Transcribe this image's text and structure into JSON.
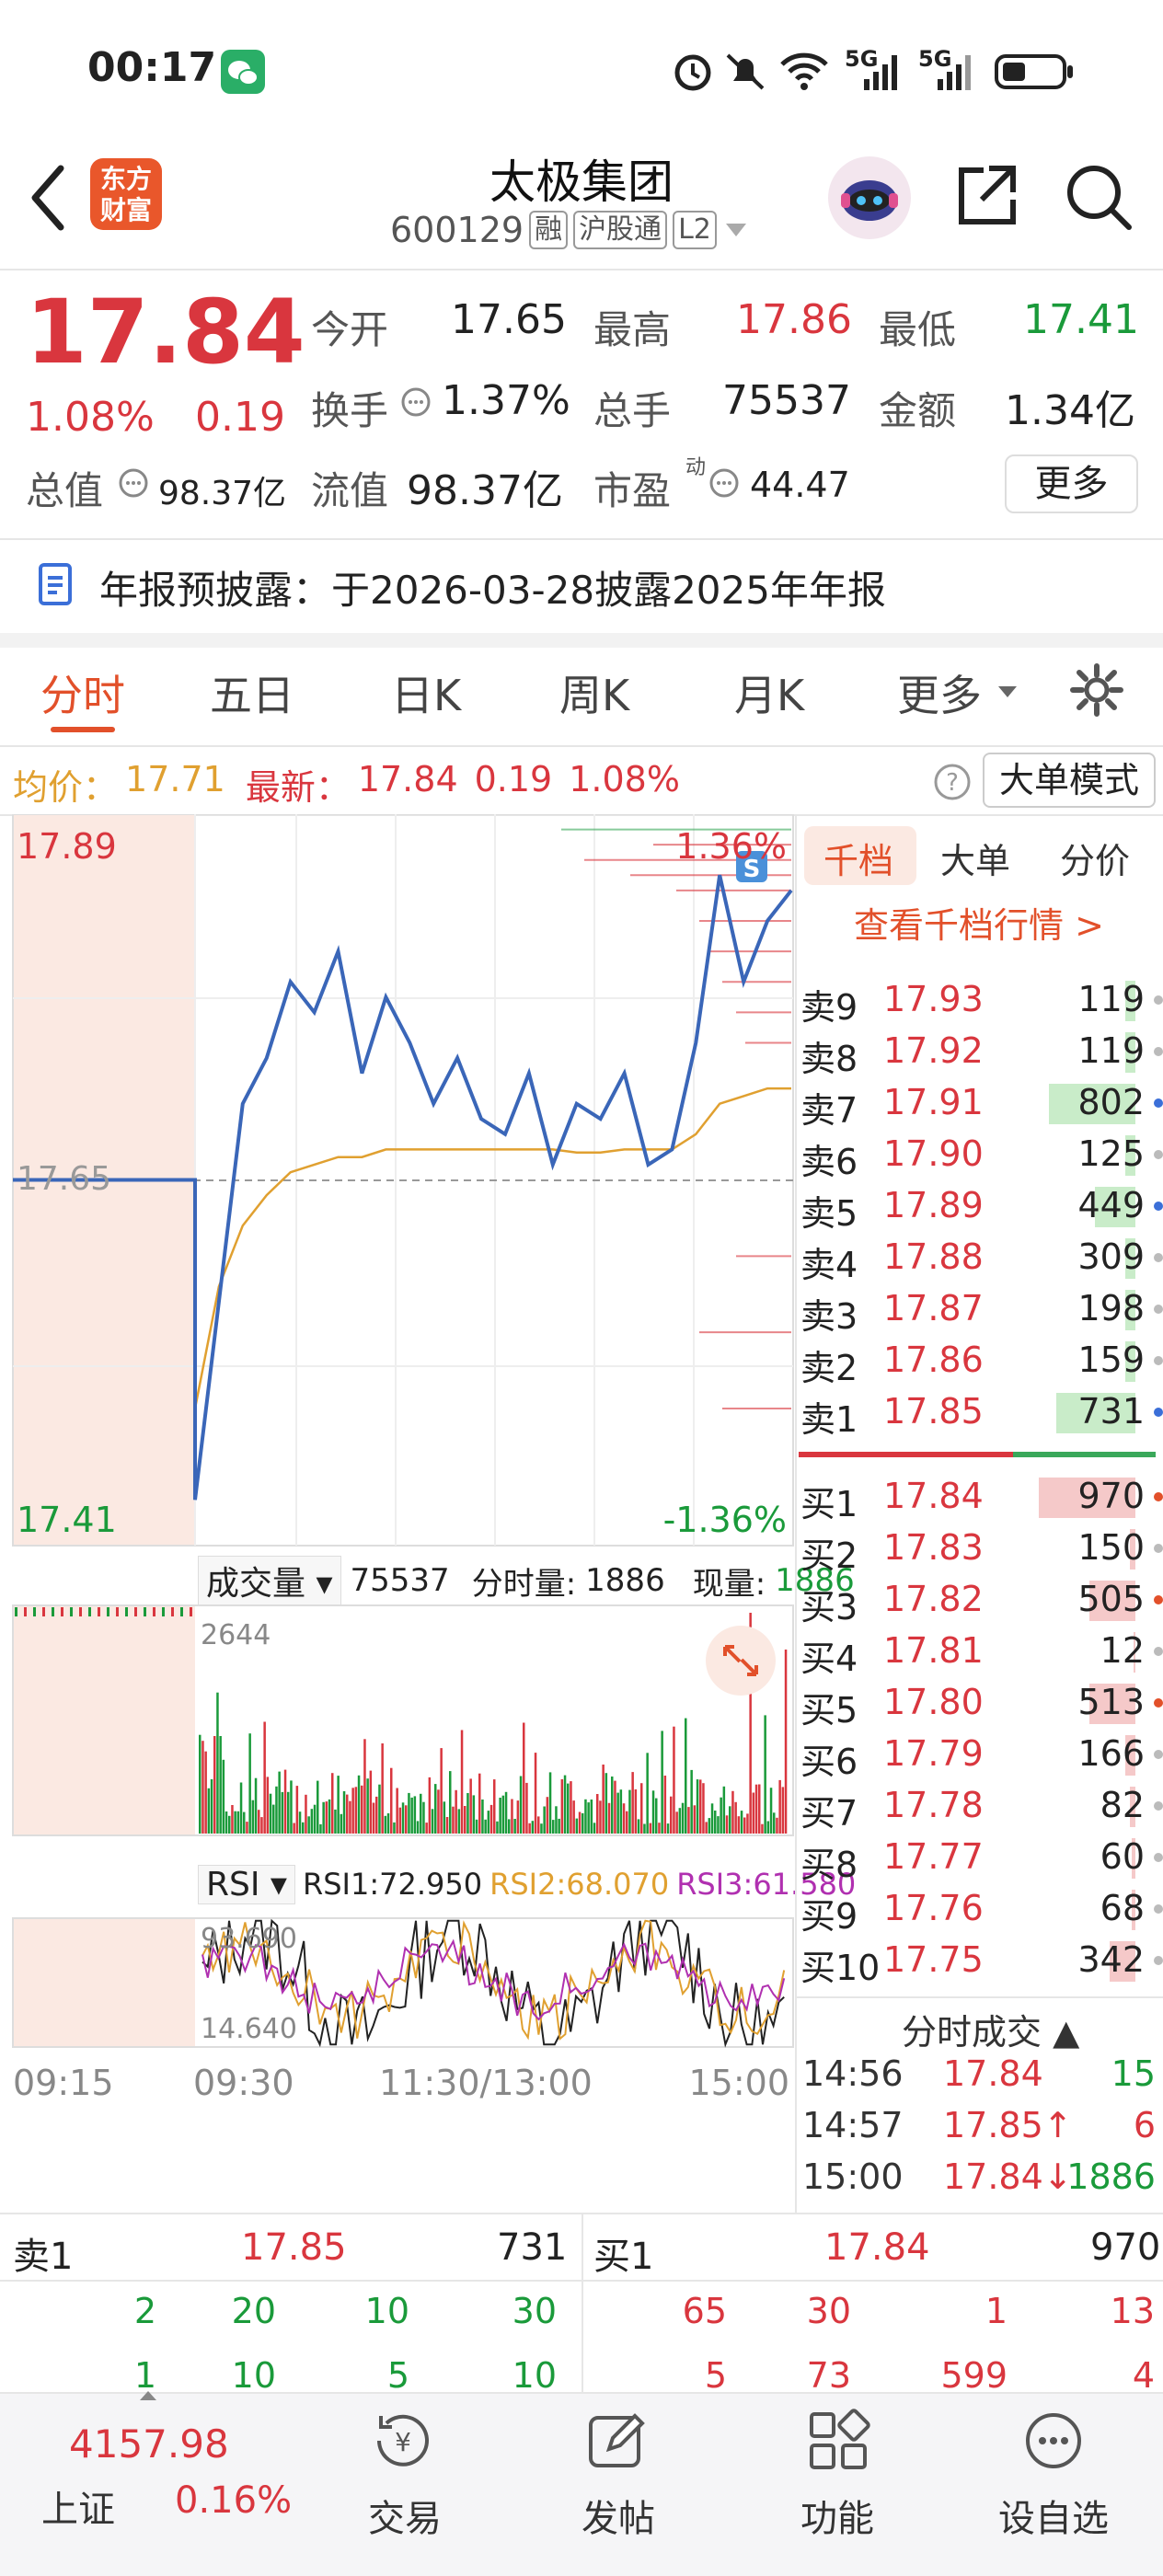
{
  "status_bar": {
    "time": "00:17",
    "net1": "5G",
    "net2": "5G"
  },
  "header": {
    "title": "太极集团",
    "code": "600129",
    "tags": [
      "融",
      "沪股通",
      "L2"
    ],
    "logo_line1": "东方",
    "logo_line2": "财富"
  },
  "quote": {
    "price": "17.84",
    "change_pct": "1.08%",
    "change": "0.19",
    "open_label": "今开",
    "open": "17.65",
    "high_label": "最高",
    "high": "17.86",
    "low_label": "最低",
    "low": "17.41",
    "turnover_label": "换手",
    "turnover": "1.37%",
    "volume_label": "总手",
    "volume": "75537",
    "amount_label": "金额",
    "amount": "1.34亿",
    "mktcap_label": "总值",
    "mktcap": "98.37亿",
    "float_label": "流值",
    "float": "98.37亿",
    "pe_label": "市盈",
    "pe_sup": "动",
    "pe": "44.47",
    "more_button": "更多"
  },
  "notice": {
    "text": "年报预披露：于2026-03-28披露2025年年报"
  },
  "tabs": [
    "分时",
    "五日",
    "日K",
    "周K",
    "月K",
    "更多"
  ],
  "active_tab": 0,
  "chart_info": {
    "avg_label": "均价：",
    "avg": "17.71",
    "latest_label": "最新：",
    "latest": "17.84",
    "latest_change": "0.19",
    "latest_pct": "1.08%",
    "mode_button": "大单模式"
  },
  "chart_labels": {
    "top_price": "17.89",
    "top_pct": "1.36%",
    "bottom_price": "17.41",
    "bottom_pct": "-1.36%",
    "mid_price": "17.65",
    "vol_selector": "成交量",
    "vol_total": "75537",
    "vol_minute_label": "分时量:",
    "vol_minute": "1886",
    "vol_now_label": "现量:",
    "vol_now": "1886",
    "vol_max": "2644",
    "rsi_selector": "RSI",
    "rsi1": "RSI1:72.950",
    "rsi2": "RSI2:68.070",
    "rsi3": "RSI3:61.580",
    "rsi_max": "93.690",
    "rsi_min": "14.640",
    "x_ticks": [
      "09:15",
      "09:30",
      "11:30/13:00",
      "15:00"
    ],
    "s_badge": "S"
  },
  "chart_data": {
    "type": "line",
    "series": [
      {
        "name": "最新",
        "values": [
          17.65,
          17.65,
          17.65,
          17.44,
          17.57,
          17.7,
          17.73,
          17.78,
          17.76,
          17.8,
          17.72,
          17.77,
          17.74,
          17.7,
          17.73,
          17.69,
          17.68,
          17.72,
          17.66,
          17.7,
          17.69,
          17.72,
          17.66,
          17.67,
          17.74,
          17.85,
          17.78,
          17.82,
          17.84
        ]
      },
      {
        "name": "均价",
        "values": [
          17.65,
          17.65,
          17.65,
          17.5,
          17.58,
          17.62,
          17.64,
          17.655,
          17.66,
          17.665,
          17.665,
          17.67,
          17.67,
          17.67,
          17.67,
          17.67,
          17.67,
          17.67,
          17.67,
          17.668,
          17.668,
          17.67,
          17.67,
          17.67,
          17.68,
          17.7,
          17.705,
          17.71,
          17.71
        ]
      }
    ],
    "ylim": [
      17.41,
      17.89
    ],
    "xlabel": "",
    "ylabel": ""
  },
  "order_tabs": [
    "千档",
    "大单",
    "分价"
  ],
  "order_link": "查看千档行情 >",
  "asks": [
    {
      "label": "卖9",
      "price": "17.93",
      "vol": "119",
      "bar": 0.1
    },
    {
      "label": "卖8",
      "price": "17.92",
      "vol": "119",
      "bar": 0.1
    },
    {
      "label": "卖7",
      "price": "17.91",
      "vol": "802",
      "bar": 0.85
    },
    {
      "label": "卖6",
      "price": "17.90",
      "vol": "125",
      "bar": 0.1
    },
    {
      "label": "卖5",
      "price": "17.89",
      "vol": "449",
      "bar": 0.4
    },
    {
      "label": "卖4",
      "price": "17.88",
      "vol": "309",
      "bar": 0.1
    },
    {
      "label": "卖3",
      "price": "17.87",
      "vol": "198",
      "bar": 0.1
    },
    {
      "label": "卖2",
      "price": "17.86",
      "vol": "159",
      "bar": 0.1
    },
    {
      "label": "卖1",
      "price": "17.85",
      "vol": "731",
      "bar": 0.78
    }
  ],
  "bids": [
    {
      "label": "买1",
      "price": "17.84",
      "vol": "970",
      "bar": 0.95
    },
    {
      "label": "买2",
      "price": "17.83",
      "vol": "150",
      "bar": 0.05
    },
    {
      "label": "买3",
      "price": "17.82",
      "vol": "505",
      "bar": 0.45
    },
    {
      "label": "买4",
      "price": "17.81",
      "vol": "12",
      "bar": 0.02
    },
    {
      "label": "买5",
      "price": "17.80",
      "vol": "513",
      "bar": 0.45
    },
    {
      "label": "买6",
      "price": "17.79",
      "vol": "166",
      "bar": 0.1
    },
    {
      "label": "买7",
      "price": "17.78",
      "vol": "82",
      "bar": 0.05
    },
    {
      "label": "买8",
      "price": "17.77",
      "vol": "60",
      "bar": 0.04
    },
    {
      "label": "买9",
      "price": "17.76",
      "vol": "68",
      "bar": 0.04
    },
    {
      "label": "买10",
      "price": "17.75",
      "vol": "342",
      "bar": 0.25
    }
  ],
  "trades_header": "分时成交",
  "trades": [
    {
      "time": "14:56",
      "price": "17.84",
      "vol": "15",
      "arrow": ""
    },
    {
      "time": "14:57",
      "price": "17.85↑",
      "vol": "6",
      "arrow": ""
    },
    {
      "time": "15:00",
      "price": "17.84↓",
      "vol": "1886",
      "arrow": ""
    }
  ],
  "level2": {
    "ask_label": "卖1",
    "ask_price": "17.85",
    "ask_vol": "731",
    "bid_label": "买1",
    "bid_price": "17.84",
    "bid_vol": "970",
    "ask_queue1": [
      "2",
      "20",
      "10",
      "30"
    ],
    "ask_queue2": [
      "1",
      "10",
      "5",
      "10"
    ],
    "bid_queue1": [
      "65",
      "30",
      "1",
      "13"
    ],
    "bid_queue2": [
      "5",
      "73",
      "599",
      "4"
    ]
  },
  "bottom_bar": {
    "index_value": "4157.98",
    "index_name": "上证",
    "index_pct": "0.16%",
    "items": [
      "交易",
      "发帖",
      "功能",
      "设自选"
    ]
  }
}
